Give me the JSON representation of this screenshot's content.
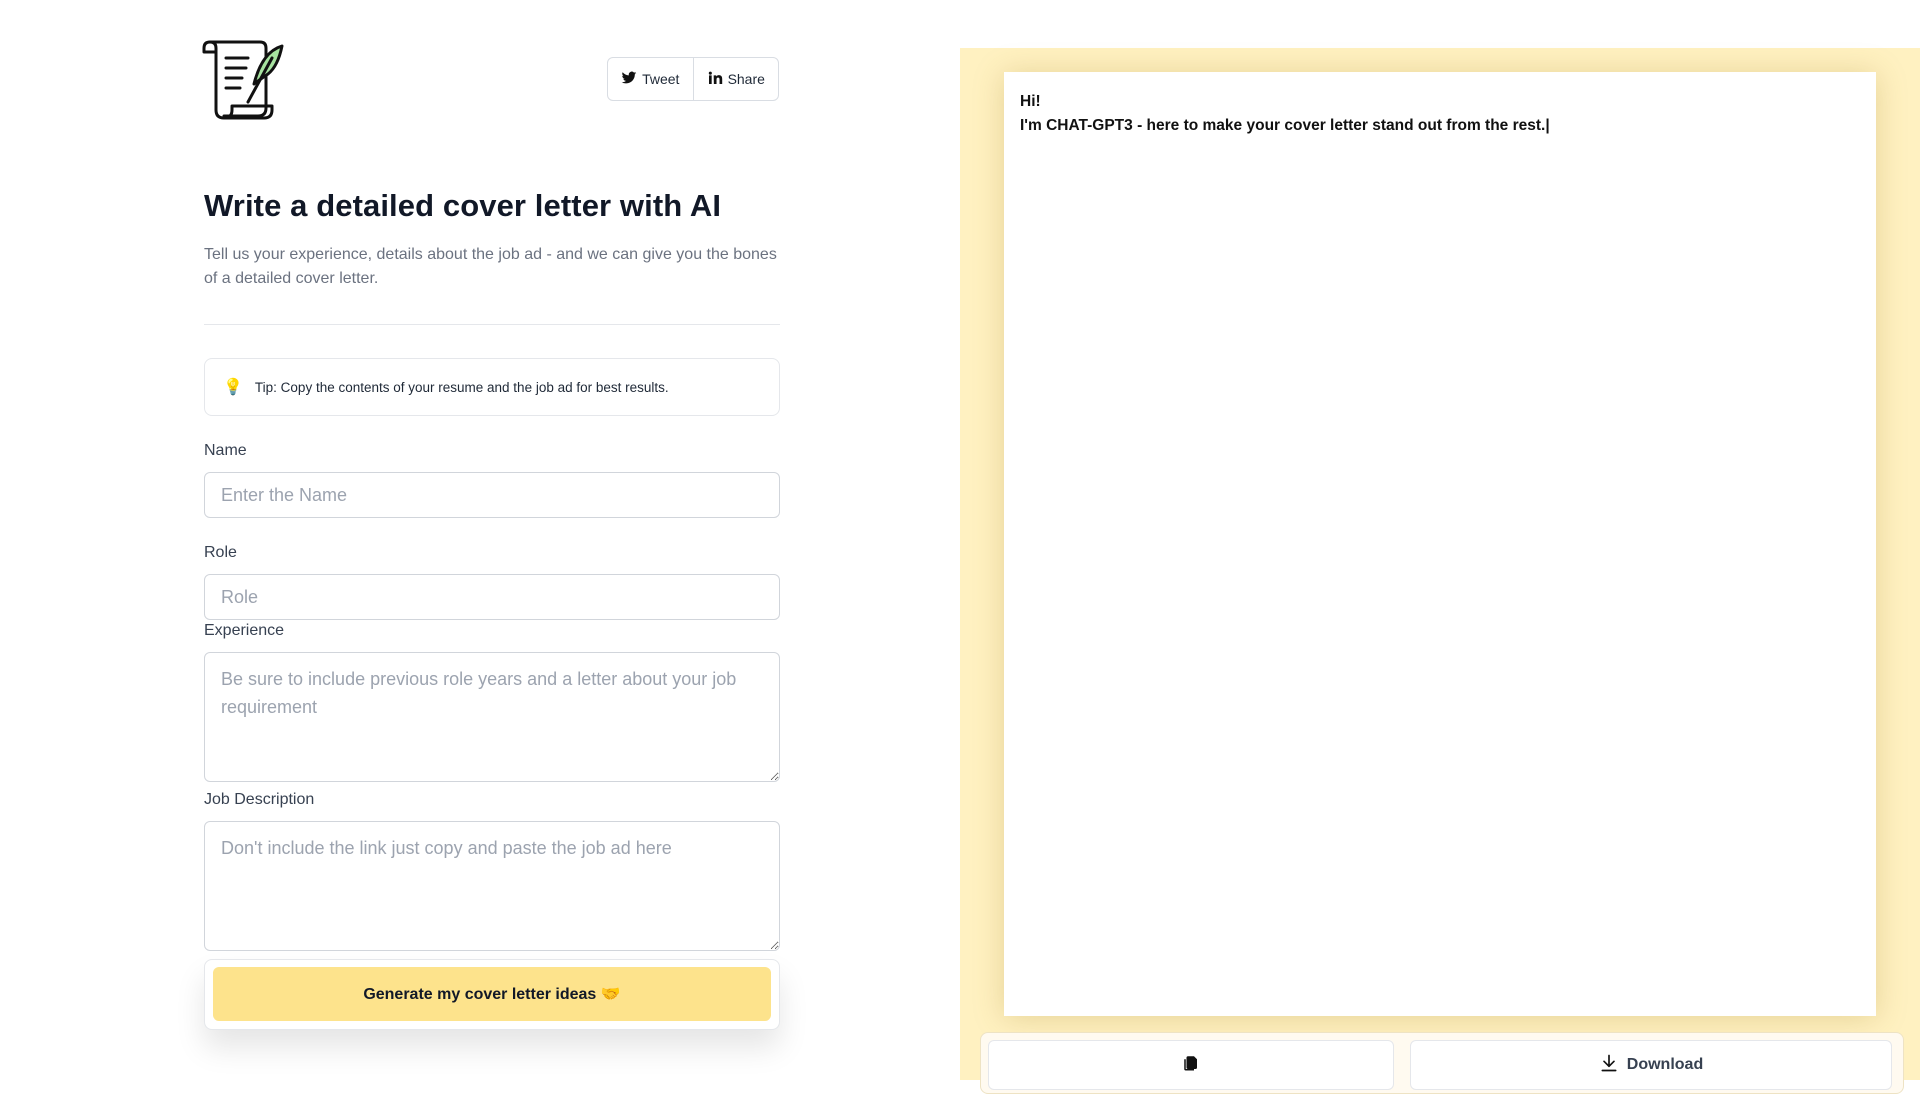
{
  "header": {
    "tweet_label": "Tweet",
    "share_label": "Share"
  },
  "intro": {
    "title": "Write a detailed cover letter with AI",
    "subtitle": "Tell us your experience, details about the job ad - and we can give you the bones of a detailed cover letter."
  },
  "tip": {
    "icon": "lightbulb-icon",
    "text": "Tip: Copy the contents of your resume and the job ad for best results."
  },
  "form": {
    "name": {
      "label": "Name",
      "placeholder": "Enter the Name",
      "value": ""
    },
    "role": {
      "label": "Role",
      "placeholder": "Role",
      "value": ""
    },
    "experience": {
      "label": "Experience",
      "placeholder": "Be sure to include previous role years and a letter about your job requirement",
      "value": ""
    },
    "job_description": {
      "label": "Job Description",
      "placeholder": "Don't include the link just copy and paste the job ad here",
      "value": ""
    },
    "generate_label": "Generate my cover letter ideas 🤝"
  },
  "output": {
    "line1": "Hi!",
    "line2": "I'm CHAT-GPT3 - here to make your cover letter stand out from the rest.|",
    "download_label": "Download"
  },
  "colors": {
    "accent": "#fde38c",
    "panel_bg": "#fff1c1"
  }
}
